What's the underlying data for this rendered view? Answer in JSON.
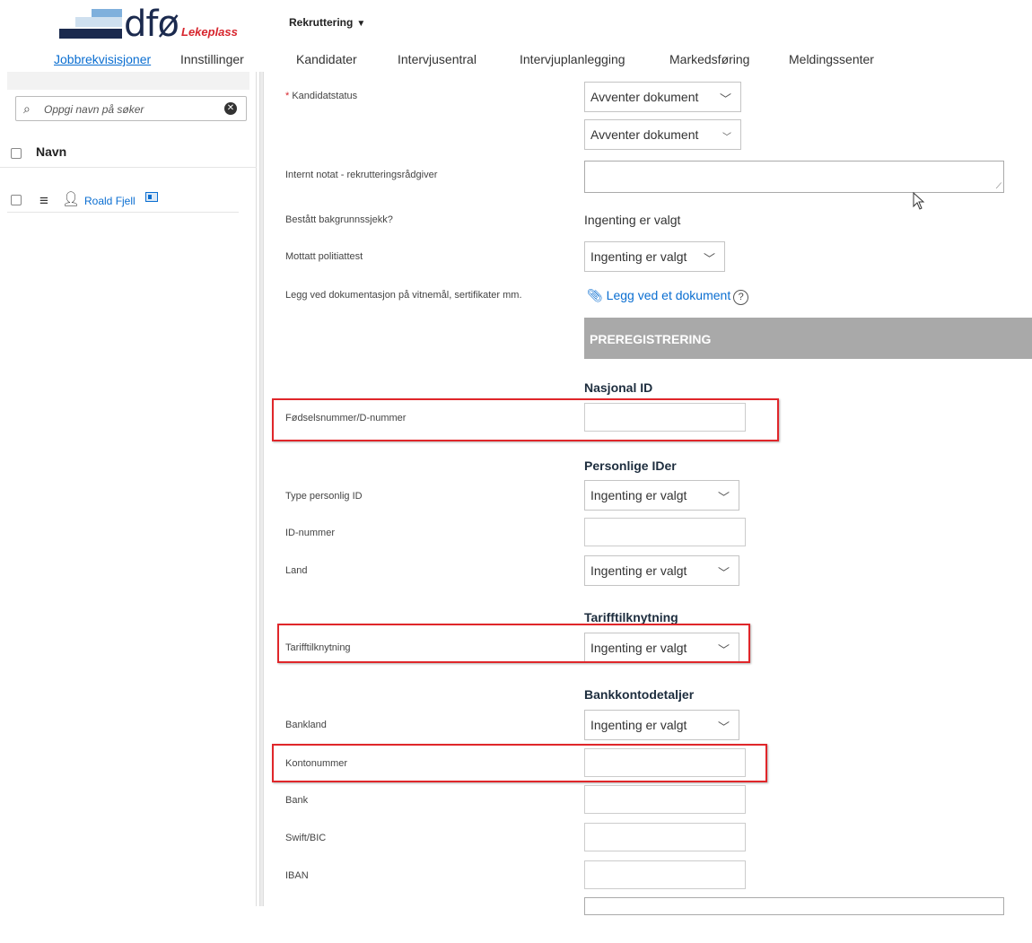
{
  "header": {
    "logo_text": "dfø",
    "logo_suffix": "Lekeplass",
    "menu_label": "Rekruttering"
  },
  "nav": {
    "items": [
      "Jobbrekvisisjoner",
      "Innstillinger",
      "Kandidater",
      "Intervjusentral",
      "Intervjuplanlegging",
      "Markedsføring",
      "Meldingssenter"
    ]
  },
  "left_panel": {
    "search_placeholder": "Oppgi navn på søker",
    "column_header": "Navn",
    "candidate_name": "Roald Fjell"
  },
  "form": {
    "required_mark": "*",
    "kandidatstatus_label": "Kandidatstatus",
    "kandidatstatus_value_1": "Avventer dokument",
    "kandidatstatus_value_2": "Avventer dokument",
    "internt_notat_label": "Internt notat - rekrutteringsrådgiver",
    "bakgrunnssjekk_label": "Bestått bakgrunnssjekk?",
    "bakgrunnssjekk_value": "Ingenting er valgt",
    "politiattest_label": "Mottatt politiattest",
    "politiattest_value": "Ingenting er valgt",
    "dokumentasjon_label": "Legg ved dokumentasjon på vitnemål, sertifikater mm.",
    "attach_link": "Legg ved et dokument",
    "help_symbol": "?",
    "section_title": "PREREGISTRERING",
    "nasjonal_id_heading": "Nasjonal ID",
    "fodselsnummer_label": "Fødselsnummer/D-nummer",
    "personlige_ider_heading": "Personlige IDer",
    "type_personlig_id_label": "Type personlig ID",
    "type_personlig_id_value": "Ingenting er valgt",
    "id_nummer_label": "ID-nummer",
    "land_label": "Land",
    "land_value": "Ingenting er valgt",
    "tariff_heading": "Tarifftilknytning",
    "tariff_label": "Tarifftilknytning",
    "tariff_value": "Ingenting er valgt",
    "bank_heading": "Bankkontodetaljer",
    "bankland_label": "Bankland",
    "bankland_value": "Ingenting er valgt",
    "kontonummer_label": "Kontonummer",
    "bank_label": "Bank",
    "swift_label": "Swift/BIC",
    "iban_label": "IBAN"
  },
  "colors": {
    "link": "#0a6ed1",
    "highlight": "#e0262a",
    "section_bar": "#a9a9a9"
  }
}
